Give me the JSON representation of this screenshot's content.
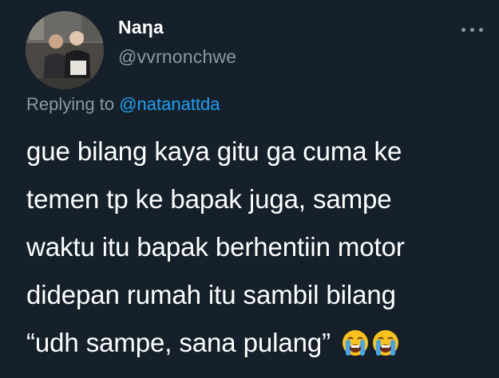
{
  "tweet": {
    "display_name": "Naηa",
    "handle": "@vvrnonchwe",
    "replying_prefix": "Replying to",
    "replying_mention": "@natanattda",
    "lines": [
      "gue bilang kaya gitu ga cuma ke",
      "temen tp ke bapak juga, sampe",
      "waktu itu bapak berhentiin motor",
      "didepan rumah itu sambil bilang",
      "“udh sampe, sana pulang”"
    ],
    "emojis": [
      "loudly-crying-face-icon",
      "loudly-crying-face-icon"
    ]
  },
  "colors": {
    "background": "#15202b",
    "text": "#ffffff",
    "secondary": "#8899a6",
    "link": "#1da1f2"
  }
}
